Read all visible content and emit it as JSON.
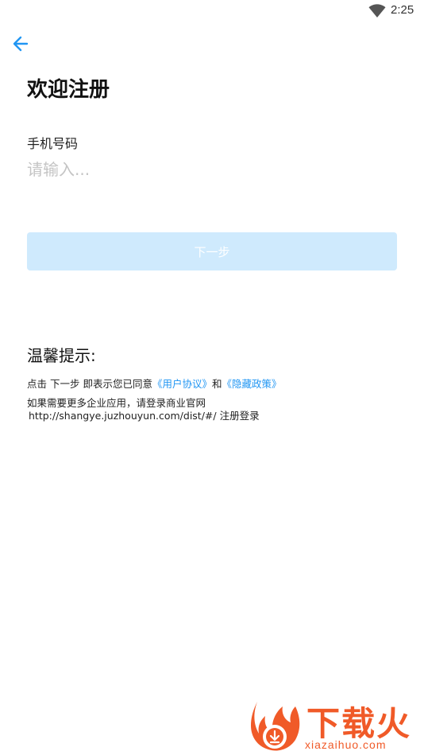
{
  "status_bar": {
    "time": "2:25",
    "wifi_icon": "wifi-icon"
  },
  "header": {
    "back_icon": "arrow-left-icon",
    "title": "欢迎注册"
  },
  "form": {
    "phone_label": "手机号码",
    "phone_placeholder": "请输入...",
    "phone_value": "",
    "next_label": "下一步"
  },
  "tips": {
    "title": "温馨提示:",
    "agree_prefix": "点击 下一步 即表示您已同意",
    "user_agreement": "《用户协议》",
    "and": "和",
    "privacy_policy": "《隐藏政策》",
    "enterprise_text": "如果需要更多企业应用，请登录商业官网",
    "url_text": "http://shangye.juzhouyun.com/dist/#/ 注册登录"
  },
  "watermark": {
    "brand": "下载火",
    "domain": "xiazaihuo.com"
  },
  "colors": {
    "accent": "#2196f3",
    "button_disabled_bg": "#cfeafd",
    "placeholder": "#c4c4c4",
    "watermark": "#f05a28"
  }
}
